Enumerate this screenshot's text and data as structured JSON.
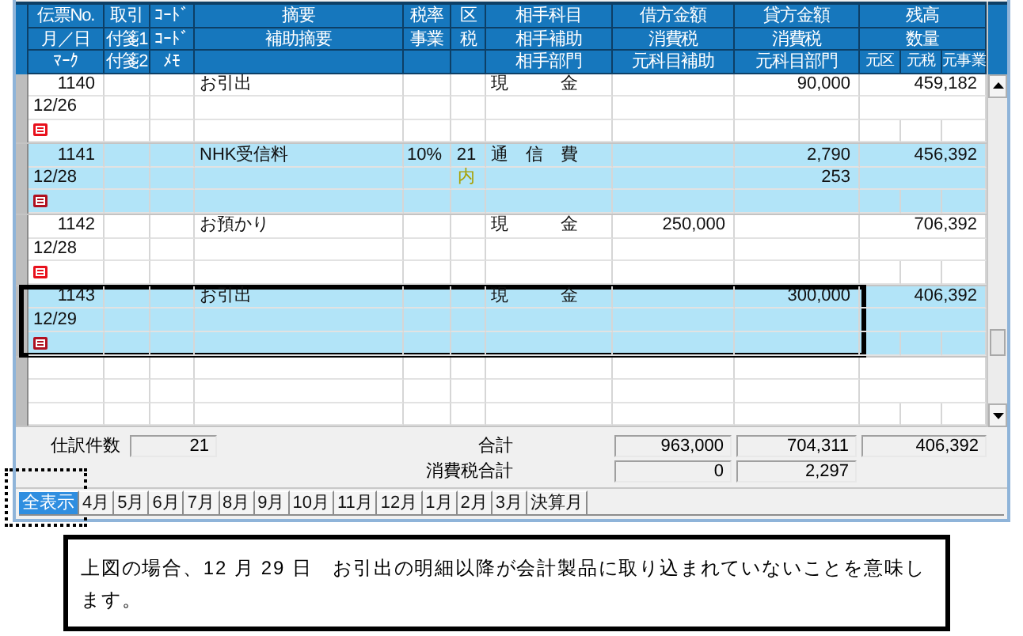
{
  "table": {
    "header_rows": [
      [
        "伝票No.",
        "取引",
        "ｺｰﾄﾞ",
        "摘要",
        "税率",
        "区",
        "相手科目",
        "借方金額",
        "貸方金額",
        "残高"
      ],
      [
        "月／日",
        "付箋1",
        "ｺｰﾄﾞ",
        "補助摘要",
        "事業",
        "税",
        "相手補助",
        "消費税",
        "消費税",
        "数量"
      ],
      [
        "ﾏｰｸ",
        "付箋2",
        "ﾒﾓ",
        "",
        "",
        "",
        "相手部門",
        "元科目補助",
        "元科目部門",
        "元区",
        "元税",
        "元事業"
      ]
    ],
    "rows": [
      {
        "no": "1140",
        "date": "12/26",
        "mark": true,
        "summary": "お引出",
        "account": "現　　　金",
        "credit": "90,000",
        "balance": "459,182",
        "selected": false,
        "highlighted": false
      },
      {
        "no": "1141",
        "date": "12/28",
        "mark": true,
        "summary": "NHK受信料",
        "tax_rate": "10%",
        "tax_code": "21",
        "tax_kind": "内",
        "account": "通　信　費",
        "credit": "2,790",
        "credit_tax": "253",
        "balance": "456,392",
        "selected": true,
        "highlighted": false
      },
      {
        "no": "1142",
        "date": "12/28",
        "mark": true,
        "summary": "お預かり",
        "account": "現　　　金",
        "debit": "250,000",
        "balance": "706,392",
        "selected": false,
        "highlighted": false
      },
      {
        "no": "1143",
        "date": "12/29",
        "mark": true,
        "summary": "お引出",
        "account": "現　　　金",
        "credit": "300,000",
        "balance": "406,392",
        "selected": true,
        "highlighted": true
      }
    ]
  },
  "footer": {
    "count_label": "仕訳件数",
    "count": "21",
    "total_label": "合計",
    "debit_total": "963,000",
    "credit_total": "704,311",
    "balance_total": "406,392",
    "tax_total_label": "消費税合計",
    "debit_tax_total": "0",
    "credit_tax_total": "2,297"
  },
  "tabs": [
    {
      "label": "全表示",
      "selected": true,
      "highlighted": true
    },
    {
      "label": "4月",
      "selected": false,
      "highlighted": false
    },
    {
      "label": "5月",
      "selected": false,
      "highlighted": false
    },
    {
      "label": "6月",
      "selected": false,
      "highlighted": false
    },
    {
      "label": "7月",
      "selected": false,
      "highlighted": false
    },
    {
      "label": "8月",
      "selected": false,
      "highlighted": false
    },
    {
      "label": "9月",
      "selected": false,
      "highlighted": false
    },
    {
      "label": "10月",
      "selected": false,
      "highlighted": false
    },
    {
      "label": "11月",
      "selected": false,
      "highlighted": false
    },
    {
      "label": "12月",
      "selected": false,
      "highlighted": false
    },
    {
      "label": "1月",
      "selected": false,
      "highlighted": false
    },
    {
      "label": "2月",
      "selected": false,
      "highlighted": false
    },
    {
      "label": "3月",
      "selected": false,
      "highlighted": false
    },
    {
      "label": "決算月",
      "selected": false,
      "highlighted": false
    }
  ],
  "note": "上図の場合、12 月 29 日　お引出の明細以降が会計製品に取り込まれていないことを意味します。"
}
